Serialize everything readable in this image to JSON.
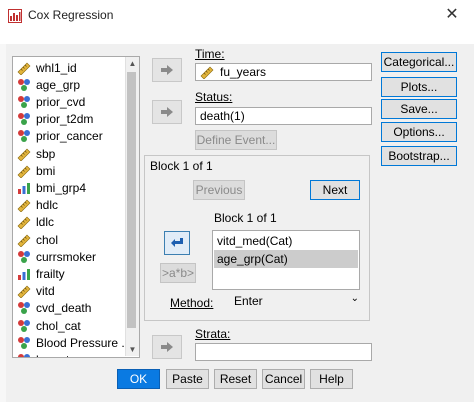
{
  "window": {
    "title": "Cox Regression",
    "close_glyph": "✕"
  },
  "variables": [
    {
      "label": "whl1_id",
      "icon": "ruler-scale-icon"
    },
    {
      "label": "age_grp",
      "icon": "nominal-icon"
    },
    {
      "label": "prior_cvd",
      "icon": "nominal-icon"
    },
    {
      "label": "prior_t2dm",
      "icon": "nominal-icon"
    },
    {
      "label": "prior_cancer",
      "icon": "nominal-icon"
    },
    {
      "label": "sbp",
      "icon": "ruler-scale-icon"
    },
    {
      "label": "bmi",
      "icon": "ruler-scale-icon"
    },
    {
      "label": "bmi_grp4",
      "icon": "ordinal-icon"
    },
    {
      "label": "hdlc",
      "icon": "ruler-scale-icon"
    },
    {
      "label": "ldlc",
      "icon": "ruler-scale-icon"
    },
    {
      "label": "chol",
      "icon": "ruler-scale-icon"
    },
    {
      "label": "currsmoker",
      "icon": "nominal-icon"
    },
    {
      "label": "frailty",
      "icon": "ordinal-icon"
    },
    {
      "label": "vitd",
      "icon": "ruler-scale-icon"
    },
    {
      "label": "cvd_death",
      "icon": "nominal-icon"
    },
    {
      "label": "chol_cat",
      "icon": "nominal-icon"
    },
    {
      "label": "Blood Pressure ...",
      "icon": "nominal-icon"
    },
    {
      "label": "hyperten",
      "icon": "nominal-icon"
    }
  ],
  "time": {
    "label": "Time:",
    "value": "fu_years"
  },
  "status": {
    "label": "Status:",
    "value": "death(1)",
    "define_event": "Define Event..."
  },
  "block": {
    "title": "Block 1 of 1",
    "previous": "Previous",
    "next": "Next",
    "inner_title": "Block 1 of 1",
    "interaction": ">a*b>",
    "covariates": [
      "vitd_med(Cat)",
      "age_grp(Cat)"
    ]
  },
  "method": {
    "label": "Method:",
    "value": "Enter"
  },
  "strata": {
    "label": "Strata:",
    "value": ""
  },
  "side_buttons": [
    "Categorical...",
    "Plots...",
    "Save...",
    "Options...",
    "Bootstrap..."
  ],
  "bottom_buttons": [
    "OK",
    "Paste",
    "Reset",
    "Cancel",
    "Help"
  ],
  "colors": {
    "primary_button": "#0a7ae2",
    "focus_border": "#0078d7",
    "selected_row": "#cccccc"
  }
}
